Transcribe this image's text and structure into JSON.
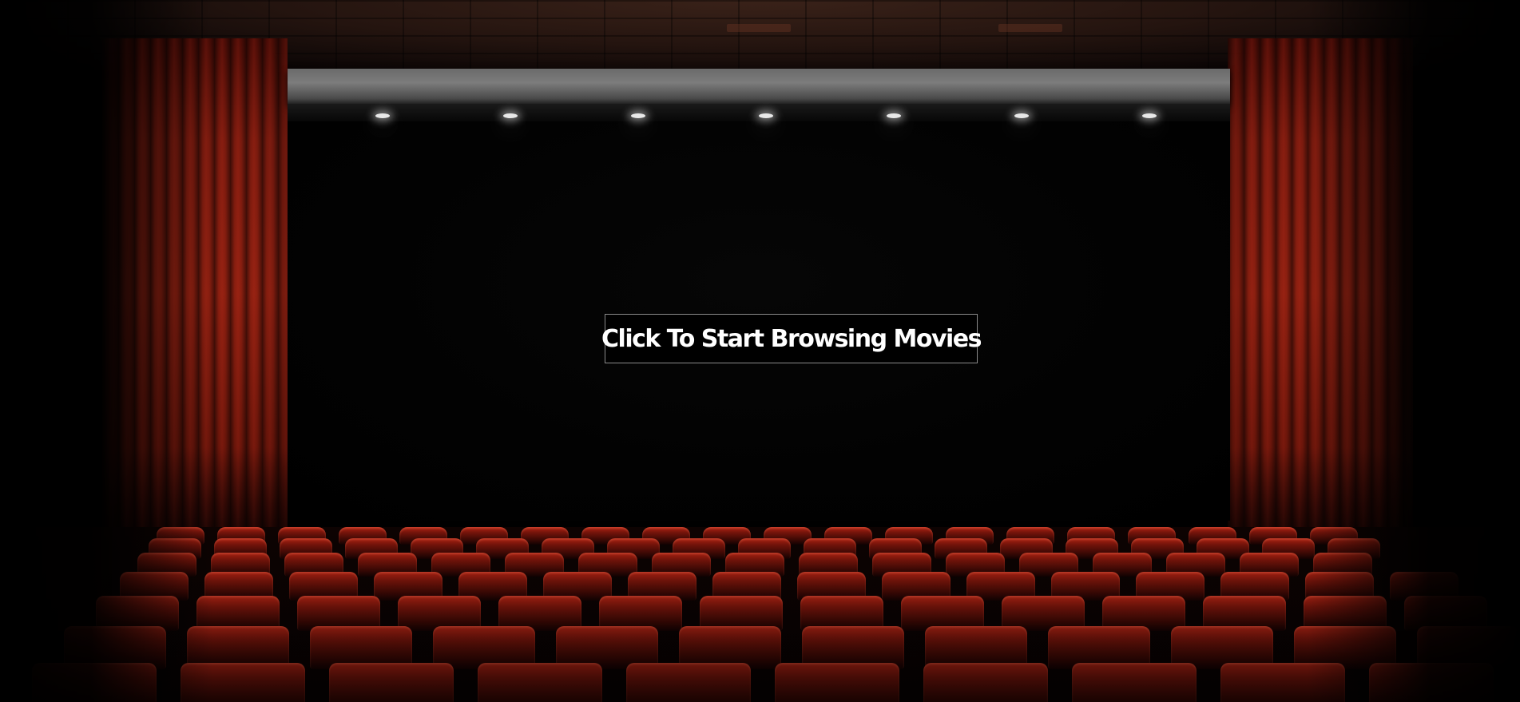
{
  "cta": {
    "label": "Click To Start Browsing Movies"
  },
  "scene": {
    "background": "movie theater",
    "curtain_color": "#8c1f10",
    "seat_color": "#b32414",
    "screen_color": "#000000"
  }
}
